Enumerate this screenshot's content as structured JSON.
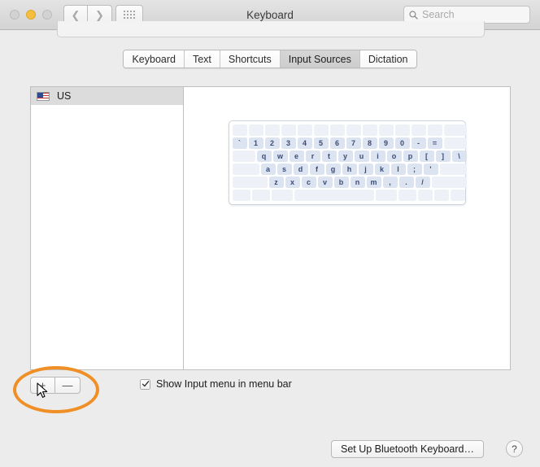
{
  "window": {
    "title": "Keyboard",
    "traffic_lights": [
      {
        "name": "close",
        "color": "#d2d2d2",
        "state": "inactive"
      },
      {
        "name": "minimize",
        "color": "#f5bf3d",
        "state": "active"
      },
      {
        "name": "zoom",
        "color": "#d2d2d2",
        "state": "inactive"
      }
    ],
    "nav": {
      "back_icon": "chevron-left-icon",
      "forward_icon": "chevron-right-icon",
      "grid_icon": "grid-of-dots-icon"
    },
    "search": {
      "placeholder": "Search",
      "value": "",
      "icon": "search-icon"
    }
  },
  "tabs": [
    {
      "label": "Keyboard",
      "active": false
    },
    {
      "label": "Text",
      "active": false
    },
    {
      "label": "Shortcuts",
      "active": false
    },
    {
      "label": "Input Sources",
      "active": true
    },
    {
      "label": "Dictation",
      "active": false
    }
  ],
  "sidebar": {
    "items": [
      {
        "label": "US",
        "icon": "us-flag-icon",
        "selected": true
      }
    ]
  },
  "keyboard_viewer": {
    "rows": [
      {
        "name": "function-row",
        "keys": [
          {
            "label": "",
            "w": 18,
            "style": "blank"
          },
          {
            "label": "",
            "w": 18,
            "style": "blank"
          },
          {
            "label": "",
            "w": 18,
            "style": "blank"
          },
          {
            "label": "",
            "w": 18,
            "style": "blank"
          },
          {
            "label": "",
            "w": 18,
            "style": "blank"
          },
          {
            "label": "",
            "w": 18,
            "style": "blank"
          },
          {
            "label": "",
            "w": 18,
            "style": "blank"
          },
          {
            "label": "",
            "w": 18,
            "style": "blank"
          },
          {
            "label": "",
            "w": 18,
            "style": "blank"
          },
          {
            "label": "",
            "w": 18,
            "style": "blank"
          },
          {
            "label": "",
            "w": 18,
            "style": "blank"
          },
          {
            "label": "",
            "w": 18,
            "style": "blank"
          },
          {
            "label": "",
            "w": 18,
            "style": "blank"
          },
          {
            "label": "",
            "w": 28,
            "style": "blank"
          }
        ]
      },
      {
        "name": "number-row",
        "keys": [
          {
            "label": "`",
            "w": 18,
            "style": "key"
          },
          {
            "label": "1",
            "w": 18,
            "style": "key"
          },
          {
            "label": "2",
            "w": 18,
            "style": "key"
          },
          {
            "label": "3",
            "w": 18,
            "style": "key"
          },
          {
            "label": "4",
            "w": 18,
            "style": "key"
          },
          {
            "label": "5",
            "w": 18,
            "style": "key"
          },
          {
            "label": "6",
            "w": 18,
            "style": "key"
          },
          {
            "label": "7",
            "w": 18,
            "style": "key"
          },
          {
            "label": "8",
            "w": 18,
            "style": "key"
          },
          {
            "label": "9",
            "w": 18,
            "style": "key"
          },
          {
            "label": "0",
            "w": 18,
            "style": "key"
          },
          {
            "label": "-",
            "w": 18,
            "style": "key"
          },
          {
            "label": "=",
            "w": 18,
            "style": "key"
          },
          {
            "label": "",
            "w": 28,
            "style": "pale"
          }
        ]
      },
      {
        "name": "top-letter-row",
        "keys": [
          {
            "label": "",
            "w": 28,
            "style": "pale"
          },
          {
            "label": "q",
            "w": 18,
            "style": "key"
          },
          {
            "label": "w",
            "w": 18,
            "style": "key"
          },
          {
            "label": "e",
            "w": 18,
            "style": "key"
          },
          {
            "label": "r",
            "w": 18,
            "style": "key"
          },
          {
            "label": "t",
            "w": 18,
            "style": "key"
          },
          {
            "label": "y",
            "w": 18,
            "style": "key"
          },
          {
            "label": "u",
            "w": 18,
            "style": "key"
          },
          {
            "label": "i",
            "w": 18,
            "style": "key"
          },
          {
            "label": "o",
            "w": 18,
            "style": "key"
          },
          {
            "label": "p",
            "w": 18,
            "style": "key"
          },
          {
            "label": "[",
            "w": 18,
            "style": "key"
          },
          {
            "label": "]",
            "w": 18,
            "style": "key"
          },
          {
            "label": "\\",
            "w": 18,
            "style": "key"
          }
        ]
      },
      {
        "name": "home-row",
        "keys": [
          {
            "label": "",
            "w": 33,
            "style": "pale"
          },
          {
            "label": "a",
            "w": 18,
            "style": "key"
          },
          {
            "label": "s",
            "w": 18,
            "style": "key"
          },
          {
            "label": "d",
            "w": 18,
            "style": "key"
          },
          {
            "label": "f",
            "w": 18,
            "style": "key"
          },
          {
            "label": "g",
            "w": 18,
            "style": "key"
          },
          {
            "label": "h",
            "w": 18,
            "style": "key"
          },
          {
            "label": "j",
            "w": 18,
            "style": "key"
          },
          {
            "label": "k",
            "w": 18,
            "style": "key"
          },
          {
            "label": "l",
            "w": 18,
            "style": "key"
          },
          {
            "label": ";",
            "w": 18,
            "style": "key"
          },
          {
            "label": "'",
            "w": 18,
            "style": "key"
          },
          {
            "label": "",
            "w": 33,
            "style": "pale"
          }
        ]
      },
      {
        "name": "bottom-letter-row",
        "keys": [
          {
            "label": "",
            "w": 43,
            "style": "pale"
          },
          {
            "label": "z",
            "w": 18,
            "style": "key"
          },
          {
            "label": "x",
            "w": 18,
            "style": "key"
          },
          {
            "label": "c",
            "w": 18,
            "style": "key"
          },
          {
            "label": "v",
            "w": 18,
            "style": "key"
          },
          {
            "label": "b",
            "w": 18,
            "style": "key"
          },
          {
            "label": "n",
            "w": 18,
            "style": "key"
          },
          {
            "label": "m",
            "w": 18,
            "style": "key"
          },
          {
            "label": ",",
            "w": 18,
            "style": "key"
          },
          {
            "label": ".",
            "w": 18,
            "style": "key"
          },
          {
            "label": "/",
            "w": 18,
            "style": "key"
          },
          {
            "label": "",
            "w": 43,
            "style": "pale"
          }
        ]
      },
      {
        "name": "modifier-row",
        "keys": [
          {
            "label": "",
            "w": 22,
            "style": "blank"
          },
          {
            "label": "",
            "w": 22,
            "style": "blank"
          },
          {
            "label": "",
            "w": 26,
            "style": "blank"
          },
          {
            "label": "",
            "w": 98,
            "style": "blank"
          },
          {
            "label": "",
            "w": 26,
            "style": "blank"
          },
          {
            "label": "",
            "w": 22,
            "style": "blank"
          },
          {
            "label": "",
            "w": 18,
            "style": "blank"
          },
          {
            "label": "",
            "w": 18,
            "style": "blank"
          },
          {
            "label": "",
            "w": 18,
            "style": "blank"
          }
        ]
      }
    ]
  },
  "bottom_controls": {
    "add_label": "+",
    "remove_label": "—",
    "checkbox": {
      "label": "Show Input menu in menu bar",
      "checked": true,
      "check_glyph": "✓"
    }
  },
  "footer": {
    "bluetooth_button": "Set Up Bluetooth Keyboard…",
    "help_button": "?"
  },
  "annotation": {
    "ellipse_color": "#ef8f25",
    "target": "add-input-source-button",
    "cursor": "arrow-pointer"
  }
}
